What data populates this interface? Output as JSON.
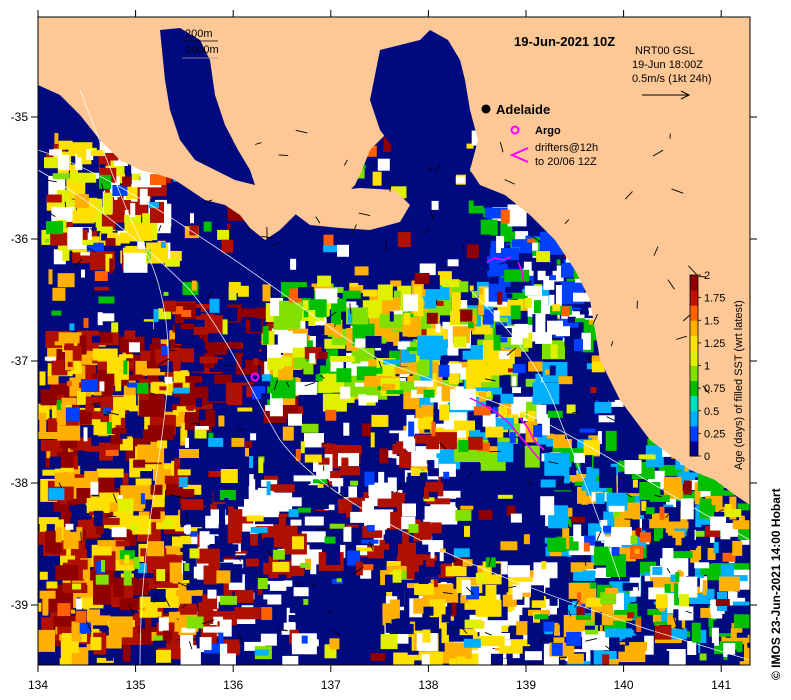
{
  "title": "19-Jun-2021 10Z",
  "depth_legend": {
    "line1": "200m",
    "line2": "1000m"
  },
  "current_legend": {
    "line1": "NRT00 GSL",
    "line2": "19-Jun 18:00Z",
    "line3": "0.5m/s (1kt 24h)"
  },
  "city": {
    "name": "Adelaide"
  },
  "argo_legend": {
    "label": "Argo"
  },
  "drifter_legend": {
    "line1": "drifters@12h",
    "line2": "to 20/06 12Z"
  },
  "colorbar": {
    "title": "Age (days) of filled SST (wrt latest)",
    "ticks": [
      "2",
      "1.75",
      "1.5",
      "1.25",
      "1",
      "0.75",
      "0.5",
      "0.25",
      "0"
    ],
    "colors": [
      "#000090",
      "#0040ff",
      "#00b0ff",
      "#00e0c0",
      "#00c000",
      "#80e000",
      "#e0f000",
      "#ffe000",
      "#ffb000",
      "#ff6000",
      "#c01000",
      "#900000"
    ]
  },
  "credit": "© IMOS 23-Jun-2021 14:00 Hobart",
  "axes": {
    "x_ticks": [
      "134",
      "135",
      "136",
      "137",
      "138",
      "139",
      "140",
      "141"
    ],
    "y_ticks": [
      "-35",
      "-36",
      "-37",
      "-38",
      "-39"
    ]
  },
  "colors": {
    "land": "#fdc896",
    "deep_water": "#000a80",
    "argo": "#ff00ff",
    "drifter": "#ff00ff"
  }
}
